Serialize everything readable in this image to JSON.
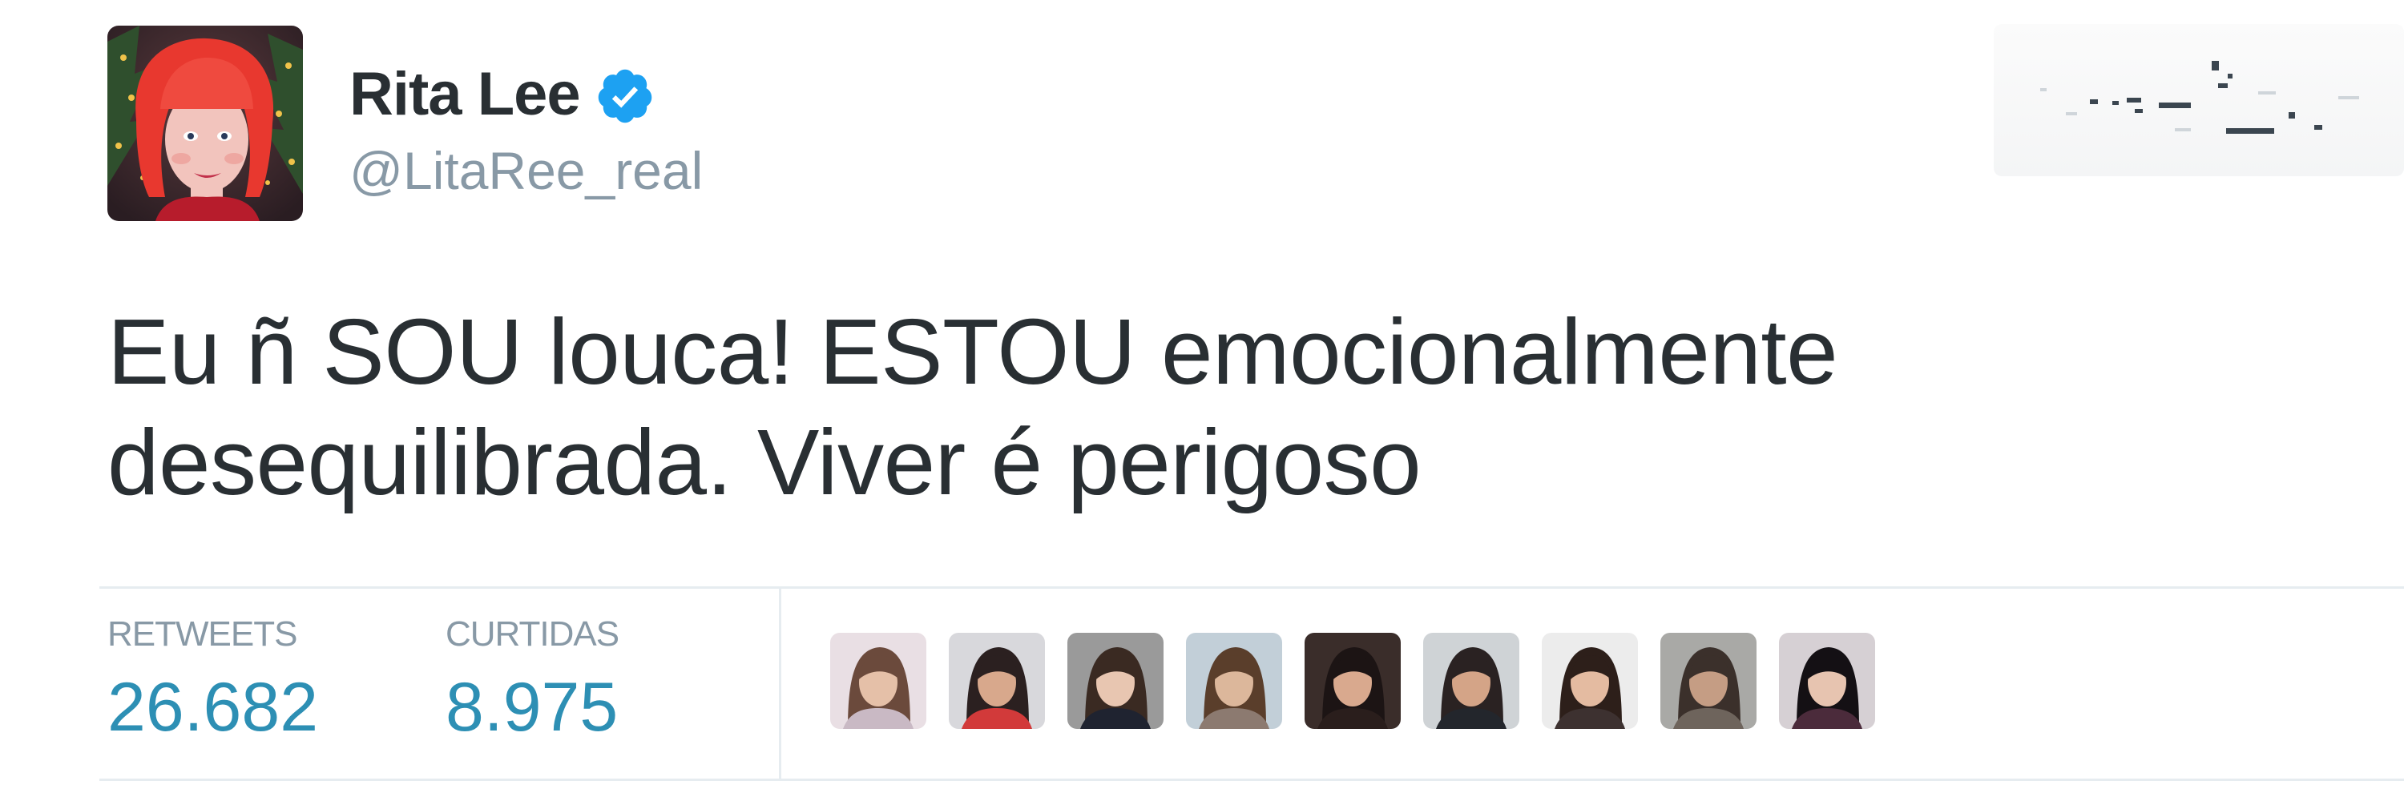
{
  "tweet": {
    "author": {
      "display_name": "Rita Lee",
      "handle": "@LitaRee_real",
      "verified": true,
      "avatar_icon": "avatar-illustration-red-hair"
    },
    "text_line_1": "Eu ñ SOU louca! ESTOU emocionalmente",
    "text_line_2": "desequilibrada. Viver é perigoso",
    "stats": {
      "retweets_label": "RETWEETS",
      "retweets_count": "26.682",
      "likes_label": "CURTIDAS",
      "likes_count": "8.975"
    },
    "likers": [
      {
        "icon": "liker-avatar-icon",
        "hair": "#6b4a3c",
        "bg": "#e9dfe4",
        "shirt": "#c9b9c4",
        "skin": "#e5c0a8"
      },
      {
        "icon": "liker-avatar-icon",
        "hair": "#2b2020",
        "bg": "#d8d8dc",
        "shirt": "#d23a3a",
        "skin": "#d8a88c"
      },
      {
        "icon": "liker-avatar-icon",
        "hair": "#3a2a22",
        "bg": "#9a9a9a",
        "shirt": "#1f2330",
        "skin": "#e8c6b1"
      },
      {
        "icon": "liker-avatar-icon",
        "hair": "#5a3e2b",
        "bg": "#c2cfd8",
        "shirt": "#8c7a70",
        "skin": "#dcb79b"
      },
      {
        "icon": "liker-avatar-icon",
        "hair": "#1c1414",
        "bg": "#3a2d2a",
        "shirt": "#2a1e1c",
        "skin": "#d9a98e"
      },
      {
        "icon": "liker-avatar-icon",
        "hair": "#2a2222",
        "bg": "#cfd3d6",
        "shirt": "#23262c",
        "skin": "#d4a487"
      },
      {
        "icon": "liker-avatar-icon",
        "hair": "#2d1f1a",
        "bg": "#ececec",
        "shirt": "#3d3130",
        "skin": "#e4bba1"
      },
      {
        "icon": "liker-avatar-icon",
        "hair": "#3b302b",
        "bg": "#a9a9a6",
        "shirt": "#6e645c",
        "skin": "#c59d84"
      },
      {
        "icon": "liker-avatar-icon",
        "hair": "#141014",
        "bg": "#d6d0d4",
        "shirt": "#4b2b3b",
        "skin": "#e7c4b0"
      }
    ]
  },
  "colors": {
    "text": "#292f33",
    "muted": "#8899a6",
    "count": "#2d8fb4",
    "verified": "#1da1f2",
    "divider": "#e6ecf0"
  }
}
